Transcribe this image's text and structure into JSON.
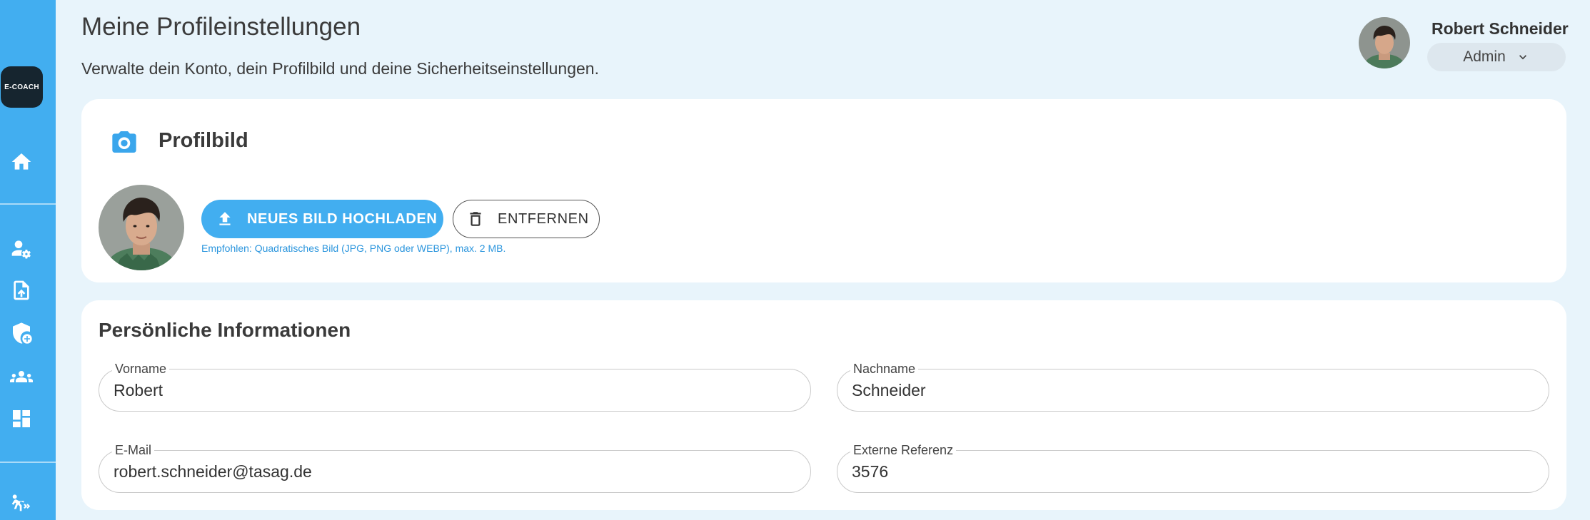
{
  "sidebar": {
    "logo_text": "E-COACH",
    "items": [
      {
        "icon": "home-icon"
      },
      {
        "icon": "user-settings-icon"
      },
      {
        "icon": "file-upload-icon"
      },
      {
        "icon": "shield-add-icon"
      },
      {
        "icon": "groups-icon"
      },
      {
        "icon": "dashboard-icon"
      },
      {
        "icon": "coaching-icon"
      }
    ],
    "color": "#42aef0"
  },
  "header": {
    "title": "Meine Profileinstellungen",
    "subtitle": "Verwalte dein Konto, dein Profilbild und deine Sicherheitseinstellungen.",
    "user_name": "Robert Schneider",
    "role": "Admin"
  },
  "photo_card": {
    "title": "Profilbild",
    "upload_label": "NEUES BILD HOCHLADEN",
    "remove_label": "ENTFERNEN",
    "hint": "Empfohlen: Quadratisches Bild (JPG, PNG oder WEBP), max. 2 MB."
  },
  "info_card": {
    "title": "Persönliche Informationen",
    "fields": {
      "vorname": {
        "label": "Vorname",
        "value": "Robert"
      },
      "nachname": {
        "label": "Nachname",
        "value": "Schneider"
      },
      "email": {
        "label": "E-Mail",
        "value": "robert.schneider@tasag.de"
      },
      "extref": {
        "label": "Externe Referenz",
        "value": "3576"
      }
    }
  },
  "colors": {
    "accent": "#42aef0",
    "background": "#e8f4fb",
    "logo_bg": "#16252f",
    "hint": "#2a95dd"
  }
}
